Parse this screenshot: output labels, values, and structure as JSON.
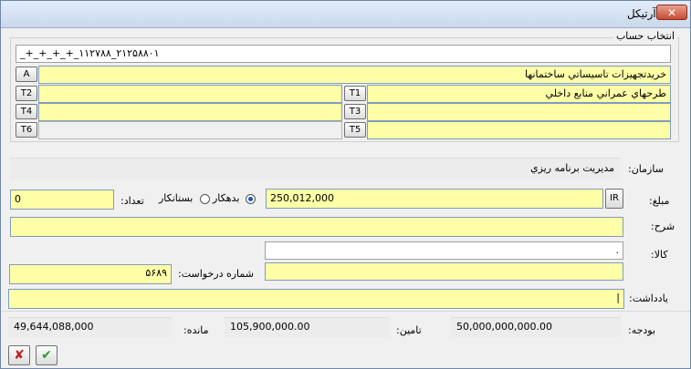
{
  "window": {
    "title": "ايجاد آرتيكل",
    "close_glyph": "✕"
  },
  "account_select": {
    "group_label": "انتخاب حساب",
    "code": "_+_+_+_+_۱۱۲۷۸۸_۲۱۲۵۸۸۰۱",
    "account_name": "خريدتجهيزات تاسيساتي ساختمانها",
    "t1_value": "طرحهاي عمراني منابع داخلي",
    "buttons": {
      "a": "A",
      "t1": "T1",
      "t2": "T2",
      "t3": "T3",
      "t4": "T4",
      "t5": "T5",
      "t6": "T6"
    }
  },
  "organization": {
    "label": "سازمان:",
    "value": "مديريت برنامه ريزي"
  },
  "amount": {
    "label": "مبلغ:",
    "currency_button": "IR",
    "value": "250,012,000",
    "debit_label": "بدهكار",
    "credit_label": "بستانكار",
    "selected": "debit",
    "count_label": "تعداد:",
    "count_value": "0"
  },
  "description": {
    "label": "شرح:",
    "value": ""
  },
  "goods": {
    "label": "كالا:",
    "value": "."
  },
  "request": {
    "label": "شماره درخواست:",
    "value": "۵۶۸۹"
  },
  "note": {
    "label": "يادداشت:",
    "value": "|"
  },
  "budget": {
    "label": "بودجه:",
    "value": "50,000,000,000.00",
    "funding_label": "تامين:",
    "funding_value": "105,900,000.00",
    "remaining_label": "مانده:",
    "remaining_value": "49,644,088,000"
  },
  "actions": {
    "cancel_glyph": "✘",
    "ok_glyph": "✔"
  },
  "colors": {
    "field_yellow": "#ffffa8",
    "titlebar": "#c9d8ec",
    "close_red": "#c74a32"
  }
}
